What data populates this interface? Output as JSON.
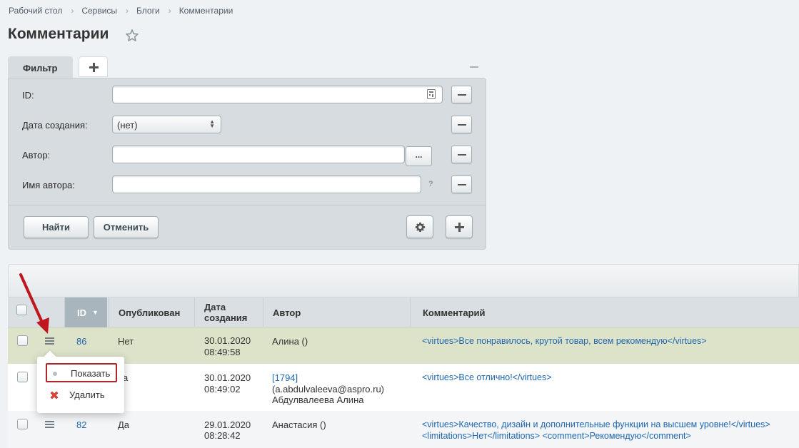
{
  "breadcrumb": [
    "Рабочий стол",
    "Сервисы",
    "Блоги",
    "Комментарии"
  ],
  "page_title": "Комментарии",
  "filter": {
    "tab_label": "Фильтр",
    "fields": {
      "id_label": "ID:",
      "date_label": "Дата создания:",
      "date_value": "(нет)",
      "author_label": "Автор:",
      "author_button": "...",
      "author_name_label": "Имя автора:",
      "help_mark": "?"
    },
    "find_label": "Найти",
    "cancel_label": "Отменить"
  },
  "table": {
    "columns": [
      "ID",
      "Опубликован",
      "Дата\nсоздания",
      "Автор",
      "Комментарий"
    ],
    "rows": [
      {
        "id": "86",
        "published": "Нет",
        "date": "30.01.2020",
        "time": "08:49:58",
        "author": "Алина ()",
        "comment": "<virtues>Все понравилось, крутой товар, всем рекомендую</virtues>"
      },
      {
        "id": "",
        "published": "а",
        "date": "30.01.2020",
        "time": "08:49:02",
        "author_link": "[1794]",
        "author_email": "(a.abdulvaleeva@aspro.ru)",
        "author_name": "Абдулвалеева Алина",
        "comment": "<virtues>Все отлично!</virtues>"
      },
      {
        "id": "82",
        "published": "Да",
        "date": "29.01.2020",
        "time": "08:28:42",
        "author": "Анастасия ()",
        "comment_line1": "<virtues>Качество, дизайн и дополнительные функции на высшем уровне!</virtues>",
        "comment_line2": "<limitations>Нет</limitations> <comment>Рекомендую</comment>"
      }
    ]
  },
  "context_menu": {
    "items": [
      "Показать",
      "Удалить"
    ]
  },
  "colors": {
    "link": "#2067b0",
    "highlight_border": "#b0262b",
    "selected_row": "#dde3c9",
    "arrow": "#c0161d"
  }
}
